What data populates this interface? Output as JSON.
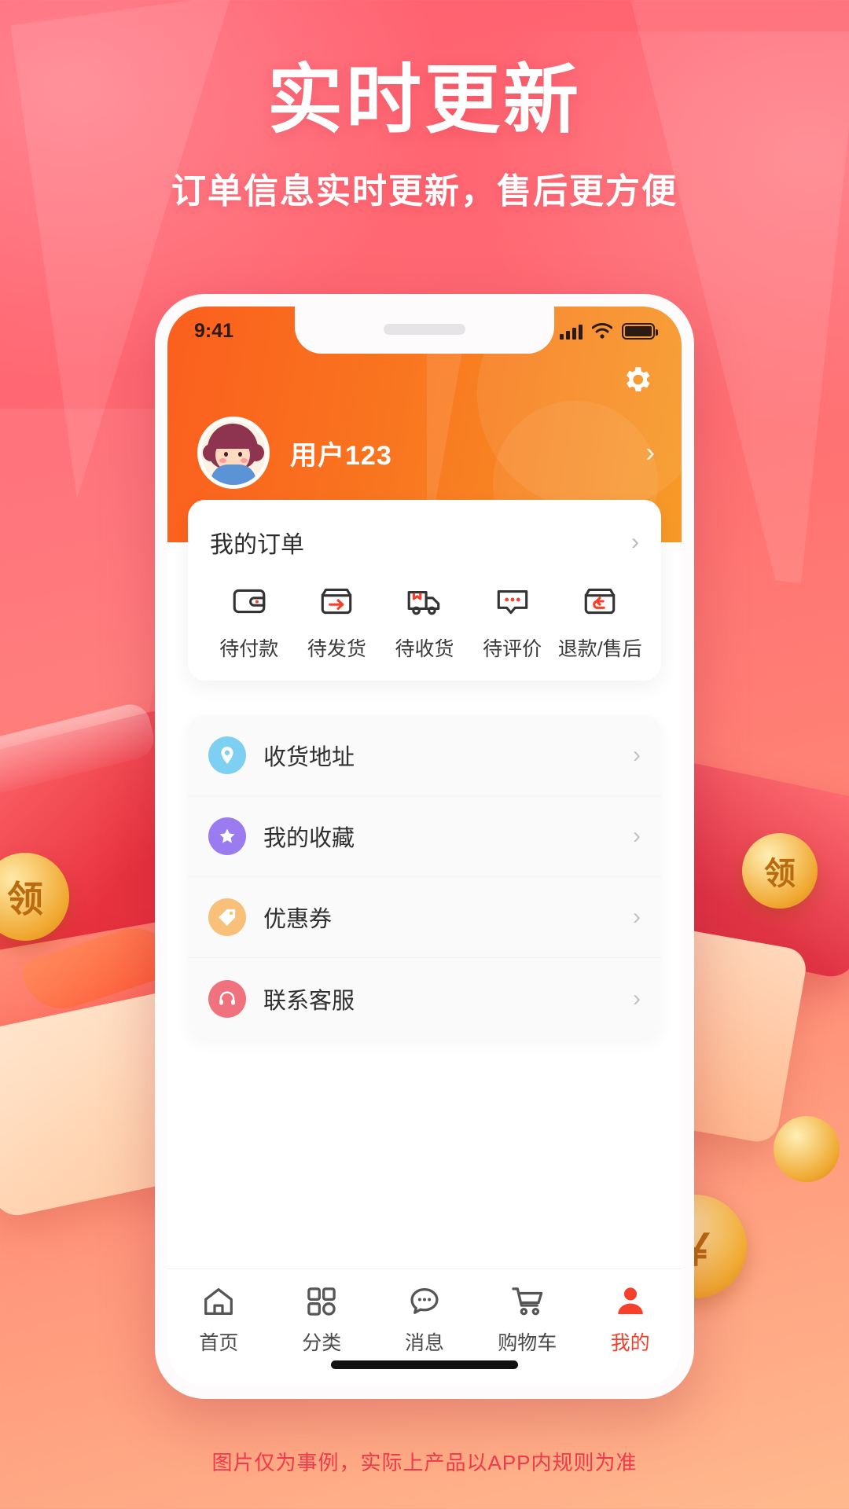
{
  "promo": {
    "title": "实时更新",
    "subtitle": "订单信息实时更新，售后更方便",
    "disclaimer": "图片仅为事例，实际上产品以APP内规则为准",
    "accent_red": "#f0394a",
    "bg_gradient_from": "#ff6070",
    "bg_gradient_to": "#ffb98d"
  },
  "phone": {
    "status_bar": {
      "time": "9:41",
      "signal_icon": "signal-bars-icon",
      "wifi_icon": "wifi-icon",
      "battery_icon": "battery-icon"
    },
    "header": {
      "settings_icon": "gear-icon",
      "avatar_icon": "avatar",
      "username": "用户123",
      "profile_arrow": "›",
      "gradient_from": "#fb5f1e",
      "gradient_to": "#f79a28"
    },
    "orders": {
      "title": "我的订单",
      "arrow": "›",
      "items": [
        {
          "label": "待付款",
          "icon": "wallet-icon"
        },
        {
          "label": "待发货",
          "icon": "box-arrow-icon"
        },
        {
          "label": "待收货",
          "icon": "truck-icon"
        },
        {
          "label": "待评价",
          "icon": "comment-icon"
        },
        {
          "label": "退款/售后",
          "icon": "refund-box-icon"
        }
      ]
    },
    "menu": {
      "arrow": "›",
      "items": [
        {
          "label": "收货地址",
          "icon": "location-pin-icon",
          "color": "#7ed0f3"
        },
        {
          "label": "我的收藏",
          "icon": "star-icon",
          "color": "#9b7cf0"
        },
        {
          "label": "优惠券",
          "icon": "tag-icon",
          "color": "#f8c078"
        },
        {
          "label": "联系客服",
          "icon": "headset-icon",
          "color": "#f0727f"
        }
      ]
    },
    "tabbar": {
      "active_color": "#f5402c",
      "items": [
        {
          "label": "首页",
          "icon": "home-icon",
          "active": false
        },
        {
          "label": "分类",
          "icon": "grid-icon",
          "active": false
        },
        {
          "label": "消息",
          "icon": "message-icon",
          "active": false
        },
        {
          "label": "购物车",
          "icon": "cart-icon",
          "active": false
        },
        {
          "label": "我的",
          "icon": "person-icon",
          "active": true
        }
      ]
    }
  }
}
